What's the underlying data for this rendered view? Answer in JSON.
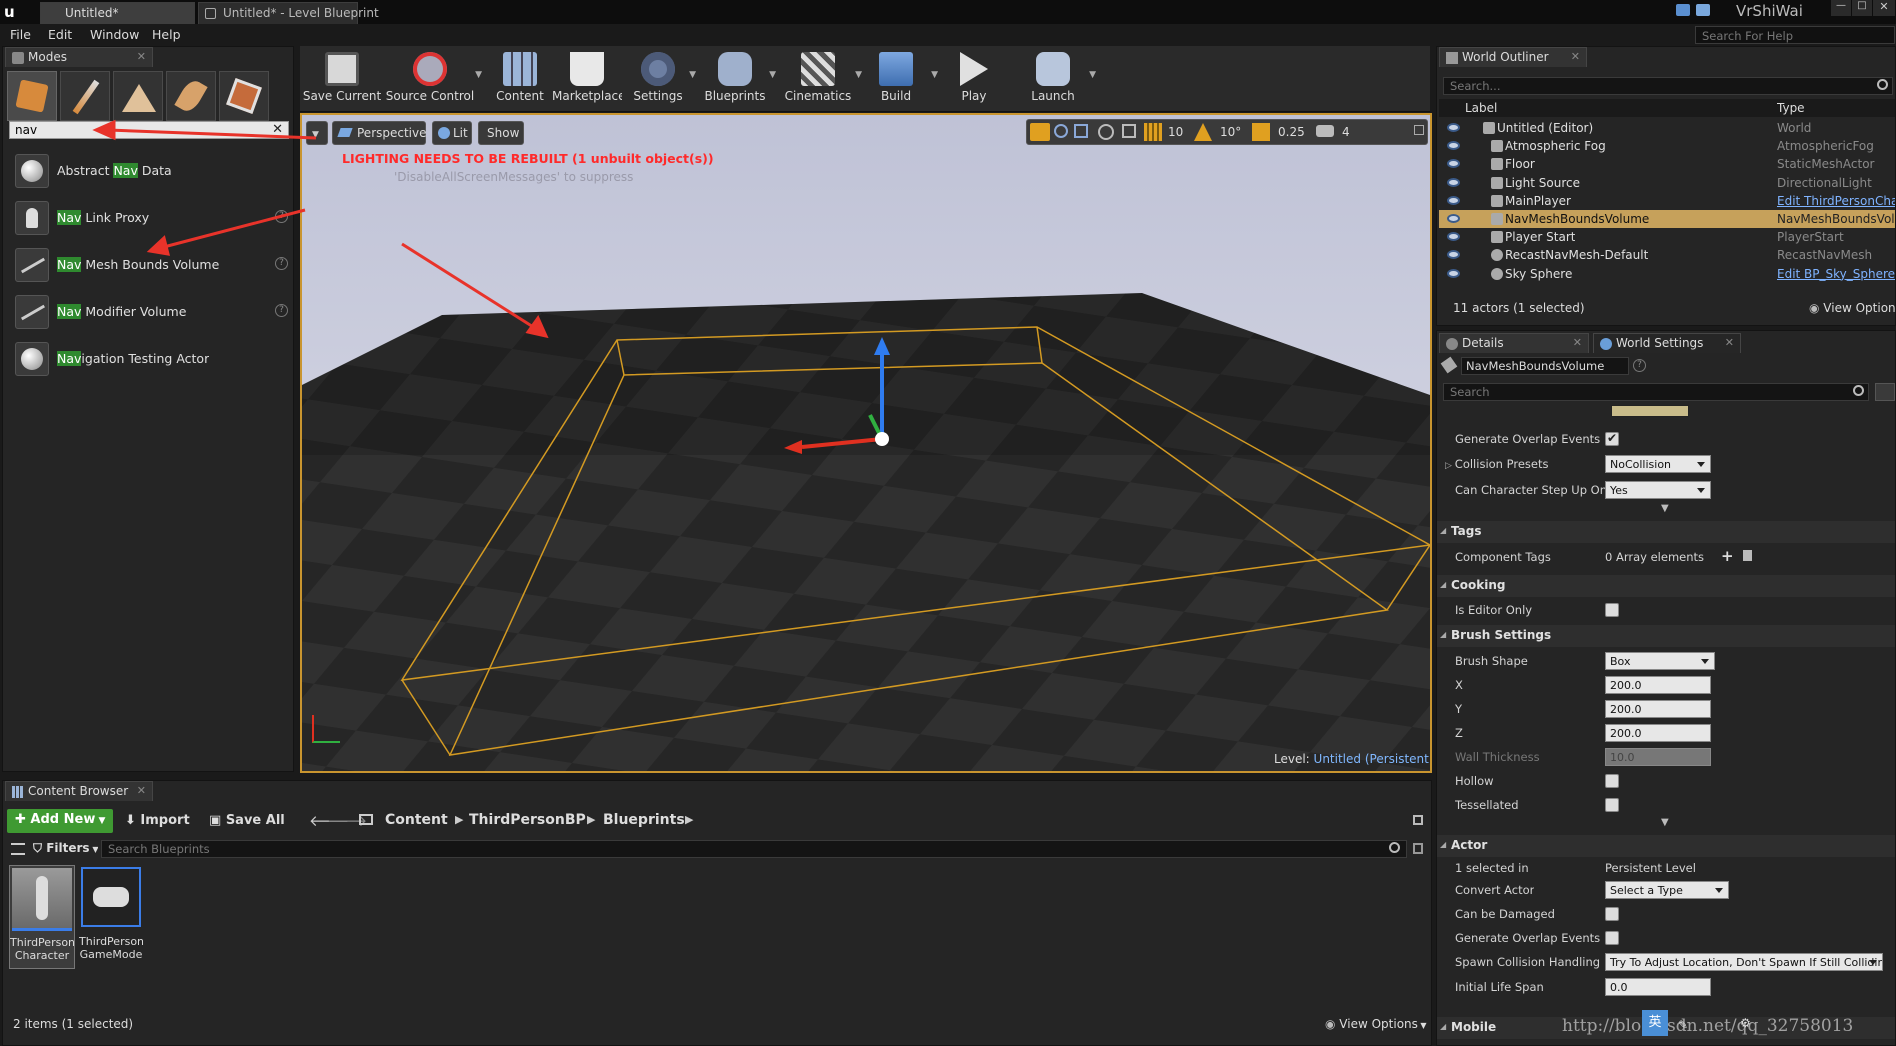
{
  "window": {
    "tabs": [
      {
        "label": "Untitled*"
      },
      {
        "label": "Untitled* - Level Blueprint"
      }
    ],
    "user": "VrShiWai",
    "help_search_placeholder": "Search For Help"
  },
  "menu": [
    "File",
    "Edit",
    "Window",
    "Help"
  ],
  "modes": {
    "tab_label": "Modes",
    "search_value": "nav",
    "items": [
      {
        "pre": "Abstract ",
        "hl": "Nav",
        "post": " Data"
      },
      {
        "pre": "",
        "hl": "Nav",
        "post": " Link Proxy"
      },
      {
        "pre": "",
        "hl": "Nav",
        "post": " Mesh Bounds Volume"
      },
      {
        "pre": "",
        "hl": "Nav",
        "post": " Modifier Volume"
      },
      {
        "pre": "",
        "hl": "Nav",
        "post": "igation Testing Actor"
      }
    ]
  },
  "toolbar": {
    "buttons": [
      "Save Current",
      "Source Control",
      "Content",
      "Marketplace",
      "Settings",
      "Blueprints",
      "Cinematics",
      "Build",
      "Play",
      "Launch"
    ]
  },
  "viewport": {
    "perspective": "Perspective",
    "lit": "Lit",
    "show": "Show",
    "warning": "LIGHTING NEEDS TO BE REBUILT (1 unbuilt object(s))",
    "suppress": "'DisableAllScreenMessages' to suppress",
    "grid_snap": "10",
    "rot_snap": "10°",
    "scale_snap": "0.25",
    "cam_speed": "4",
    "level_label": "Level:",
    "level_name": "Untitled (Persistent)"
  },
  "outliner": {
    "tab_label": "World Outliner",
    "search_placeholder": "Search...",
    "col_label": "Label",
    "col_type": "Type",
    "rows": [
      {
        "label": "Untitled (Editor)",
        "type": "World",
        "link": false
      },
      {
        "label": "Atmospheric Fog",
        "type": "AtmosphericFog",
        "link": false
      },
      {
        "label": "Floor",
        "type": "StaticMeshActor",
        "link": false
      },
      {
        "label": "Light Source",
        "type": "DirectionalLight",
        "link": false
      },
      {
        "label": "MainPlayer",
        "type": "Edit ThirdPersonChar",
        "link": true
      },
      {
        "label": "NavMeshBoundsVolume",
        "type": "NavMeshBoundsVolu",
        "link": false
      },
      {
        "label": "Player Start",
        "type": "PlayerStart",
        "link": false
      },
      {
        "label": "RecastNavMesh-Default",
        "type": "RecastNavMesh",
        "link": false
      },
      {
        "label": "Sky Sphere",
        "type": "Edit BP_Sky_Sphere",
        "link": true
      }
    ],
    "status": "11 actors (1 selected)",
    "view_options": "View Options"
  },
  "details": {
    "tab_details": "Details",
    "tab_world_settings": "World Settings",
    "object_name": "NavMeshBoundsVolume",
    "search_placeholder": "Search",
    "gen_overlap": "Generate Overlap Events",
    "collision_presets": "Collision Presets",
    "collision_value": "NoCollision",
    "step_up": "Can Character Step Up On",
    "step_up_value": "Yes",
    "tags_section": "Tags",
    "component_tags": "Component Tags",
    "array_elements": "0 Array elements",
    "cooking_section": "Cooking",
    "editor_only": "Is Editor Only",
    "brush_section": "Brush Settings",
    "brush_shape": "Brush Shape",
    "brush_shape_value": "Box",
    "x_label": "X",
    "x_value": "200.0",
    "y_label": "Y",
    "y_value": "200.0",
    "z_label": "Z",
    "z_value": "200.0",
    "wall_thickness": "Wall Thickness",
    "wall_value": "10.0",
    "hollow": "Hollow",
    "tessellated": "Tessellated",
    "actor_section": "Actor",
    "selected_in": "1 selected in",
    "persistent_level": "Persistent Level",
    "convert_actor": "Convert Actor",
    "convert_value": "Select a Type",
    "can_be_damaged": "Can be Damaged",
    "gen_overlap_during": "Generate Overlap Events Dur",
    "spawn_collision": "Spawn Collision Handling Me",
    "spawn_value": "Try To Adjust Location, Don't Spawn If Still Collidin",
    "initial_life": "Initial Life Span",
    "initial_life_value": "0.0",
    "mobile_section": "Mobile"
  },
  "content_browser": {
    "tab_label": "Content Browser",
    "add_new": "Add New",
    "import": "Import",
    "save_all": "Save All",
    "path": [
      "Content",
      "ThirdPersonBP",
      "Blueprints"
    ],
    "filters": "Filters",
    "search_placeholder": "Search Blueprints",
    "assets": [
      {
        "line1": "ThirdPerson",
        "line2": "Character"
      },
      {
        "line1": "ThirdPerson",
        "line2": "GameMode"
      }
    ],
    "status": "2 items (1 selected)",
    "view_options": "View Options"
  },
  "watermark": "http://blog.csdn.net/qq_32758013",
  "colors": {
    "selection": "#c6a15b",
    "highlight": "#2f8a2f",
    "link": "#7fb3ff",
    "warning": "#ff2a2a",
    "level_name": "#80b8ff"
  }
}
